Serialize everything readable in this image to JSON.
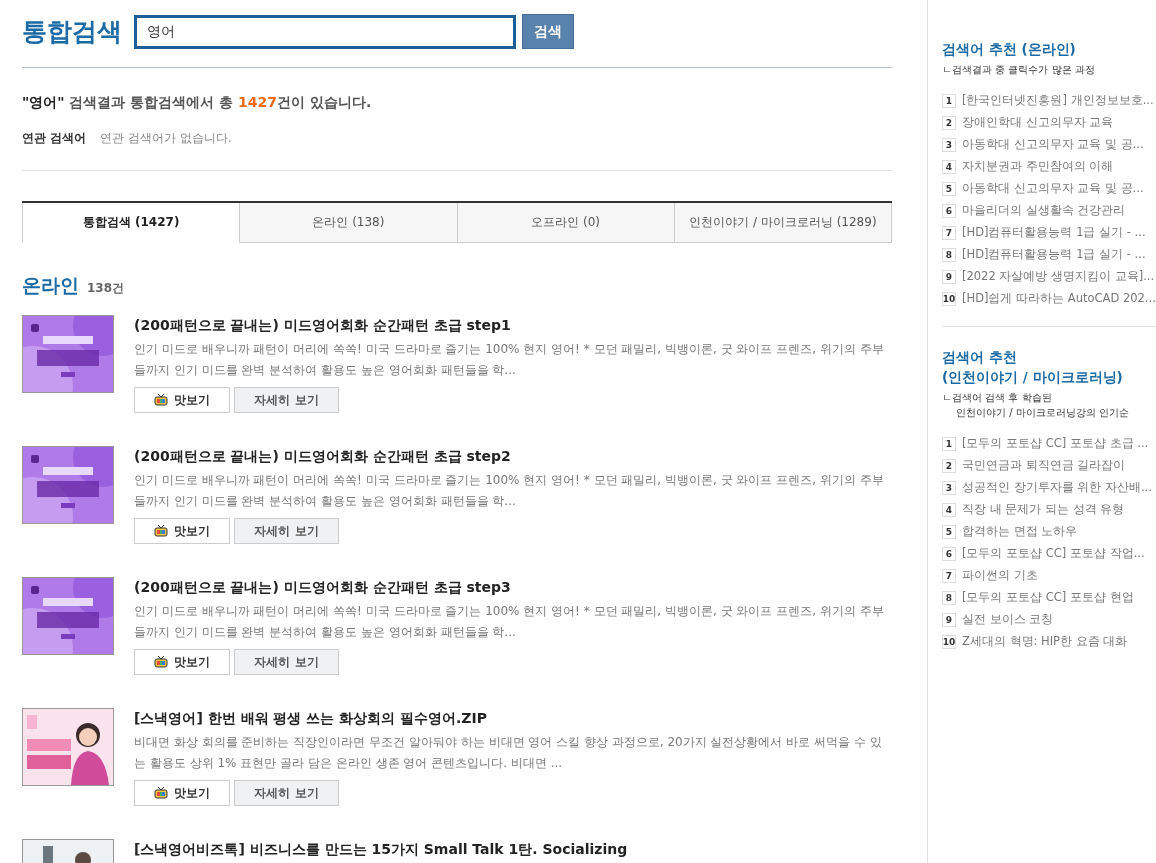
{
  "header": {
    "title": "통합검색",
    "search": {
      "value": "영어"
    },
    "search_button": "검색"
  },
  "summary": {
    "query": "\"영어\"",
    "text_before": "검색결과 통합검색에서 총",
    "count": "1427",
    "text_after": "건이 있습니다."
  },
  "related": {
    "label": "연관 검색어",
    "text": "연관 검색어가 없습니다."
  },
  "tabs": [
    {
      "label": "통합검색 (1427)",
      "selected": true
    },
    {
      "label": "온라인 (138)",
      "selected": false
    },
    {
      "label": "오프라인 (0)",
      "selected": false
    },
    {
      "label": "인천이야기 / 마이크로러닝 (1289)",
      "selected": false
    }
  ],
  "section": {
    "title": "온라인",
    "count": "138건"
  },
  "results": [
    {
      "title": "(200패턴으로 끝내는) 미드영어회화 순간패턴 초급 step1",
      "description": "인기 미드로 배우니까 패턴이 머리에 쏙쏙! 미국 드라마로 즐기는 100% 현지 영어! * 모던 패밀리, 빅뱅이론, 굿 와이프 프렌즈, 위기의 주부들까지 인기 미드를 완벽 분석하여 활용도 높은 영어회화 패턴들을 학...",
      "preview": "맛보기",
      "details": "자세히 보기",
      "kind": "picture"
    },
    {
      "title": "(200패턴으로 끝내는) 미드영어회화 순간패턴 초급 step2",
      "description": "인기 미드로 배우니까 패턴이 머리에 쏙쏙! 미국 드라마로 즐기는 100% 현지 영어! * 모던 패밀리, 빅뱅이론, 굿 와이프 프렌즈, 위기의 주부들까지 인기 미드를 완벽 분석하여 활용도 높은 영어회화 패턴들을 학...",
      "preview": "맛보기",
      "details": "자세히 보기",
      "kind": "picture"
    },
    {
      "title": "(200패턴으로 끝내는) 미드영어회화 순간패턴 초급 step3",
      "description": "인기 미드로 배우니까 패턴이 머리에 쏙쏙! 미국 드라마로 즐기는 100% 현지 영어! * 모던 패밀리, 빅뱅이론, 굿 와이프 프렌즈, 위기의 주부들까지 인기 미드를 완벽 분석하여 활용도 높은 영어회화 패턴들을 학...",
      "preview": "맛보기",
      "details": "자세히 보기",
      "kind": "picture"
    },
    {
      "title": "[스낵영어] 한번 배워 평생 쓰는 화상회의 필수영어.ZIP",
      "description": "비대면 화상 회의를 준비하는 직장인이라면 무조건 알아둬야 하는 비대면 영어 스킬 향상 과정으로, 20가지 실전상황에서 바로 써먹을 수 있는 활용도 상위 1% 표현만 골라 담은 온라인 생존 영어 콘텐츠입니다. 비대면 ...",
      "preview": "맛보기",
      "details": "자세히 보기",
      "kind": "picture"
    },
    {
      "title": "[스낵영어비즈톡] 비즈니스를 만드는 15가지 Small Talk 1탄. Socializing",
      "kind": "picture"
    }
  ],
  "sidebar": [
    {
      "title": [
        "검색어 추천 (온라인)"
      ],
      "notes": [
        "ㄴ검색결과 중 클릭수가 많은 과정"
      ],
      "items": [
        {
          "rank": "1",
          "text": "[한국인터넷진흥원] 개인정보보호..."
        },
        {
          "rank": "2",
          "text": "장애인학대 신고의무자 교육"
        },
        {
          "rank": "3",
          "text": "아동학대 신고의무자 교육 및 공..."
        },
        {
          "rank": "4",
          "text": "자치분권과 주민참여의 이해"
        },
        {
          "rank": "5",
          "text": "아동학대 신고의무자 교육 및 공..."
        },
        {
          "rank": "6",
          "text": "마을리더의 실생활속 건강관리"
        },
        {
          "rank": "7",
          "text": "[HD]컴퓨터활용능력 1급 실기 - ..."
        },
        {
          "rank": "8",
          "text": "[HD]컴퓨터활용능력 1급 실기 - ..."
        },
        {
          "rank": "9",
          "text": "[2022 자살예방 생명지킴이 교육]..."
        },
        {
          "rank": "10",
          "text": "[HD]쉽게 따라하는 AutoCAD 202..."
        }
      ]
    },
    {
      "title": [
        "검색어 추천",
        "(인천이야기 / 마이크로러닝)"
      ],
      "notes": [
        "ㄴ검색어 검색 후 학습된",
        "인천이야기 / 마이크로러닝강의 인기순"
      ],
      "items": [
        {
          "rank": "1",
          "text": "[모두의 포토샵 CC] 포토샵 초급 ..."
        },
        {
          "rank": "2",
          "text": "국민연금과 퇴직연금 길라잡이"
        },
        {
          "rank": "3",
          "text": "성공적인 장기투자를 위한 자산배..."
        },
        {
          "rank": "4",
          "text": "직장 내 문제가 되는 성격 유형"
        },
        {
          "rank": "5",
          "text": "합격하는 면접 노하우"
        },
        {
          "rank": "6",
          "text": "[모두의 포토샵 CC] 포토샵 작업..."
        },
        {
          "rank": "7",
          "text": "파이썬의 기초"
        },
        {
          "rank": "8",
          "text": "[모두의 포토샵 CC] 포토샵 현업"
        },
        {
          "rank": "9",
          "text": "실전 보이스 코칭"
        },
        {
          "rank": "10",
          "text": "Z세대의 혁명: HIP한 요즘 대화"
        }
      ]
    }
  ]
}
